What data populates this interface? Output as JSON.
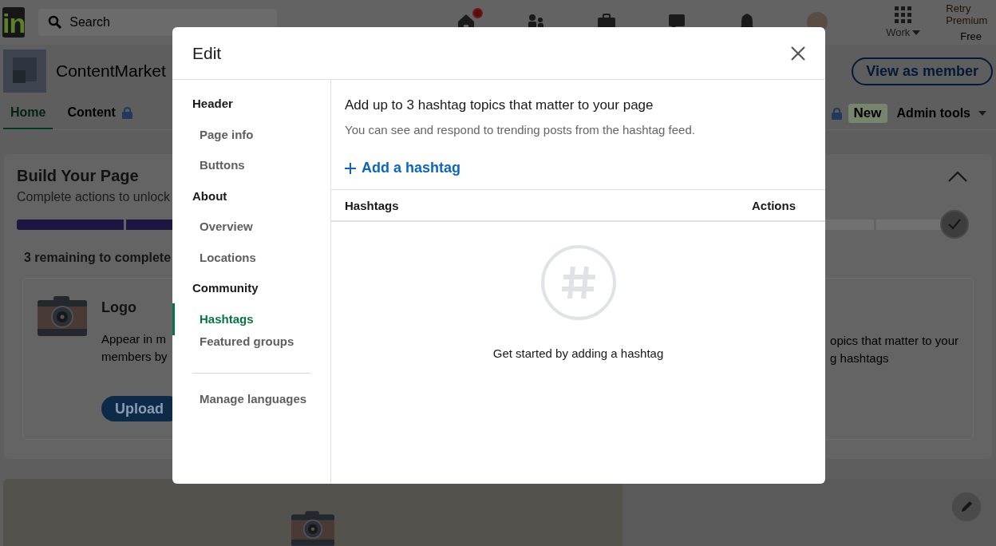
{
  "nav": {
    "logo": "in",
    "search": {
      "placeholder": "Search"
    },
    "icons": [
      {
        "kind": "home",
        "badge": true
      },
      {
        "kind": "people"
      },
      {
        "kind": "briefcase"
      },
      {
        "kind": "chat"
      },
      {
        "kind": "bell"
      },
      {
        "kind": "avatar"
      }
    ],
    "work": "Work",
    "premium": [
      "Retry Premium",
      "Free"
    ]
  },
  "page_header": {
    "name": "ContentMarket",
    "view_button": "View as member"
  },
  "tabs": [
    {
      "label": "Home",
      "selected": true,
      "locked": false
    },
    {
      "label": "Content",
      "selected": false,
      "locked": true
    }
  ],
  "right_tabs": {
    "new_badge": "New",
    "admin": "Admin tools"
  },
  "build_card": {
    "title": "Build Your Page",
    "subtitle": "Complete actions to unlock",
    "steps": [
      {
        "done": true
      },
      {
        "done": true
      },
      {
        "done": false
      },
      {
        "done": false
      }
    ],
    "remaining": "3 remaining to complete",
    "task": {
      "title": "Logo",
      "description": [
        "Appear in m",
        "members by"
      ],
      "button": "Upload",
      "right_text": [
        "opics that matter to your",
        "g hashtags"
      ]
    }
  },
  "modal": {
    "title": "Edit",
    "sidebar": [
      {
        "label": "Header",
        "kind": "section",
        "selected": false
      },
      {
        "label": "Page info",
        "kind": "item",
        "selected": false
      },
      {
        "label": "Buttons",
        "kind": "item",
        "selected": false
      },
      {
        "label": "About",
        "kind": "section",
        "selected": false
      },
      {
        "label": "Overview",
        "kind": "item",
        "selected": false
      },
      {
        "label": "Locations",
        "kind": "item",
        "selected": false
      },
      {
        "label": "Community",
        "kind": "section",
        "selected": false
      },
      {
        "label": "Hashtags",
        "kind": "item",
        "selected": true
      },
      {
        "label": "Featured groups",
        "kind": "item",
        "selected": false
      },
      {
        "label": "Manage languages",
        "kind": "footer",
        "selected": false
      }
    ],
    "heading": "Add up to 3 hashtag topics that matter to your page",
    "description": "You can see and respond to trending posts from the hashtag feed.",
    "add_button": "Add a hashtag",
    "table": {
      "columns": [
        "Hashtags",
        "Actions"
      ]
    },
    "empty_text": "Get started by adding a hashtag"
  }
}
